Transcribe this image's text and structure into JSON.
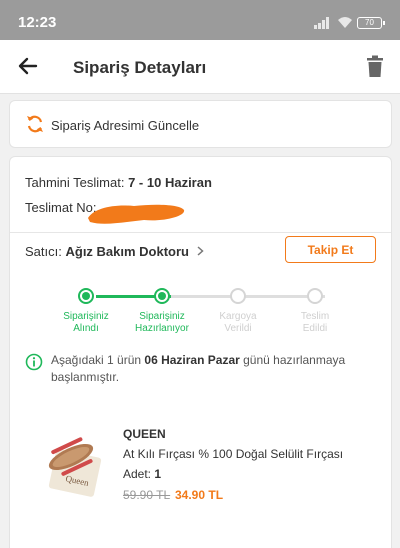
{
  "status_bar": {
    "time": "12:23",
    "battery": "70"
  },
  "header": {
    "title": "Sipariş Detayları"
  },
  "address_card": {
    "label": "Sipariş Adresimi Güncelle"
  },
  "delivery": {
    "estimate_label": "Tahmini Teslimat:",
    "estimate_value": "7 - 10 Haziran",
    "tracking_label": "Teslimat No:"
  },
  "seller": {
    "label": "Satıcı:",
    "name": "Ağız Bakım Doktoru"
  },
  "track_button": "Takip Et",
  "steps": [
    {
      "line1": "Siparişiniz",
      "line2": "Alındı",
      "state": "done"
    },
    {
      "line1": "Siparişiniz",
      "line2": "Hazırlanıyor",
      "state": "done"
    },
    {
      "line1": "Kargoya",
      "line2": "Verildi",
      "state": "todo"
    },
    {
      "line1": "Teslim",
      "line2": "Edildi",
      "state": "todo"
    }
  ],
  "info": {
    "before": "Aşağıdaki 1 ürün ",
    "date": "06 Haziran Pazar",
    "after": " günü hazırlanmaya başlanmıştır."
  },
  "product": {
    "brand": "QUEEN",
    "name": "At Kılı Fırçası % 100 Doğal Selülit Fırçası",
    "qty_label": "Adet:",
    "qty_value": "1",
    "old_price": "59.90 TL",
    "new_price": "34.90 TL"
  },
  "colors": {
    "accent": "#f27a1a",
    "success": "#1fb85a",
    "statusbar": "#9b9b9b"
  }
}
